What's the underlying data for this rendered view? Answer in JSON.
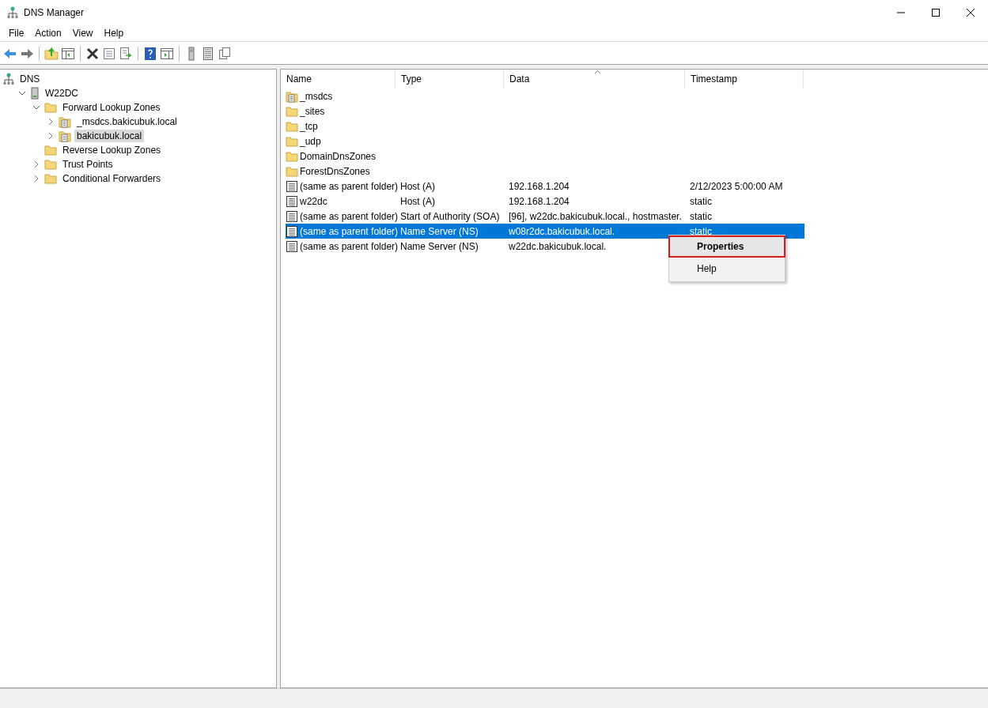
{
  "window": {
    "title": "DNS Manager"
  },
  "menu_bar": [
    "File",
    "Action",
    "View",
    "Help"
  ],
  "tree": [
    {
      "label": "DNS",
      "kind": "dns",
      "selected": false,
      "children": [
        {
          "label": "W22DC",
          "kind": "server",
          "expanded": true,
          "selected": false,
          "children": [
            {
              "label": "Forward Lookup Zones",
              "kind": "folder",
              "expanded": true,
              "selected": false,
              "children": [
                {
                  "label": "_msdcs.bakicubuk.local",
                  "kind": "zone",
                  "expanded": false,
                  "selected": false
                },
                {
                  "label": "bakicubuk.local",
                  "kind": "zone",
                  "expanded": false,
                  "selected": true
                }
              ]
            },
            {
              "label": "Reverse Lookup Zones",
              "kind": "folder",
              "selected": false
            },
            {
              "label": "Trust Points",
              "kind": "folder",
              "expanded": false,
              "selected": false
            },
            {
              "label": "Conditional Forwarders",
              "kind": "folder",
              "expanded": false,
              "selected": false
            }
          ]
        }
      ]
    }
  ],
  "table": {
    "columns": [
      {
        "label": "Name",
        "sorted": false
      },
      {
        "label": "Type",
        "sorted": false
      },
      {
        "label": "Data",
        "sorted": true
      },
      {
        "label": "Timestamp",
        "sorted": false
      }
    ],
    "rows": [
      {
        "kind": "zone",
        "name": "_msdcs",
        "type": "",
        "data": "",
        "timestamp": "",
        "selected": false
      },
      {
        "kind": "folder",
        "name": "_sites",
        "type": "",
        "data": "",
        "timestamp": "",
        "selected": false
      },
      {
        "kind": "folder",
        "name": "_tcp",
        "type": "",
        "data": "",
        "timestamp": "",
        "selected": false
      },
      {
        "kind": "folder",
        "name": "_udp",
        "type": "",
        "data": "",
        "timestamp": "",
        "selected": false
      },
      {
        "kind": "folder",
        "name": "DomainDnsZones",
        "type": "",
        "data": "",
        "timestamp": "",
        "selected": false
      },
      {
        "kind": "folder",
        "name": "ForestDnsZones",
        "type": "",
        "data": "",
        "timestamp": "",
        "selected": false
      },
      {
        "kind": "record",
        "name": "(same as parent folder)",
        "type": "Host (A)",
        "data": "192.168.1.204",
        "timestamp": "2/12/2023 5:00:00 AM",
        "selected": false
      },
      {
        "kind": "record",
        "name": "w22dc",
        "type": "Host (A)",
        "data": "192.168.1.204",
        "timestamp": "static",
        "selected": false
      },
      {
        "kind": "record",
        "name": "(same as parent folder)",
        "type": "Start of Authority (SOA)",
        "data": "[96], w22dc.bakicubuk.local., hostmaster.",
        "timestamp": "static",
        "selected": false
      },
      {
        "kind": "record",
        "name": "(same as parent folder)",
        "type": "Name Server (NS)",
        "data": "w08r2dc.bakicubuk.local.",
        "timestamp": "static",
        "selected": true
      },
      {
        "kind": "record",
        "name": "(same as parent folder)",
        "type": "Name Server (NS)",
        "data": "w22dc.bakicubuk.local.",
        "timestamp": "",
        "selected": false
      }
    ]
  },
  "context_menu": [
    {
      "label": "Properties",
      "highlighted": true
    },
    {
      "label": "Help",
      "highlighted": false
    }
  ]
}
